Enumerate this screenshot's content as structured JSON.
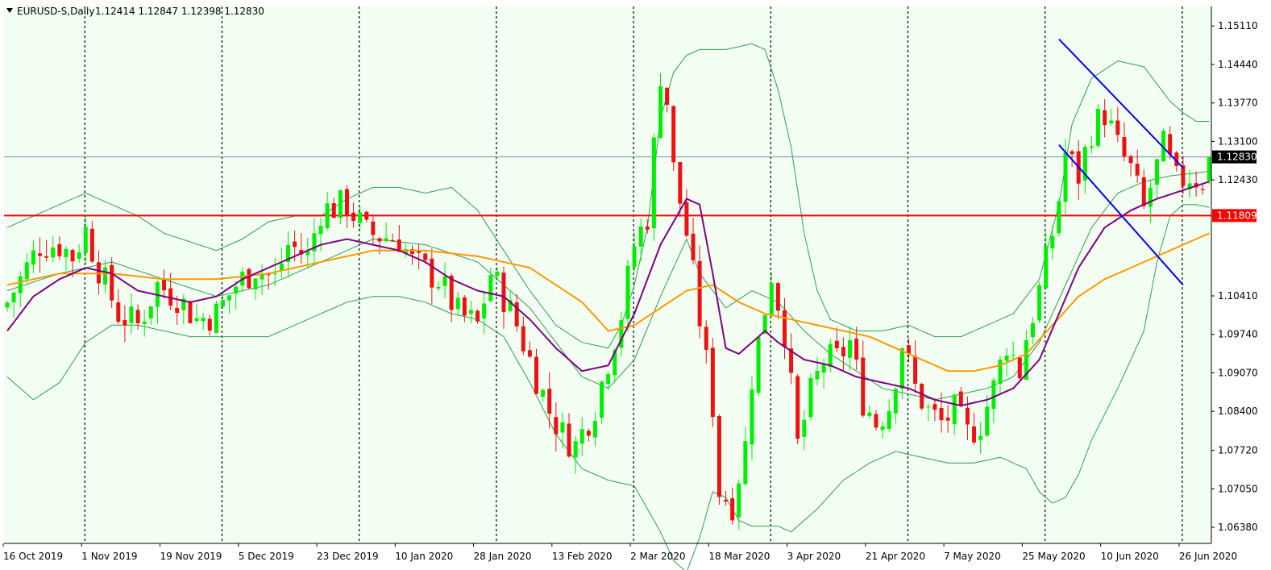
{
  "header": {
    "symbol": "EURUSD-S,Daily",
    "ohlc": "1.12414 1.12847 1.12398 1.12830"
  },
  "colors": {
    "background": "#f3fff3",
    "bull": "#00ee00",
    "bear": "#ee1111",
    "bollinger": "#2e9e52",
    "ma_fast": "#800080",
    "ma_slow": "#ff9900",
    "channel": "#0000ff",
    "support": "#ff0000",
    "last_price_line": "#6f8fa8"
  },
  "chart_data": {
    "type": "candlestick",
    "title": "",
    "ylim": [
      1.061,
      1.1545
    ],
    "yticks": [
      "1.15110",
      "1.14440",
      "1.13770",
      "1.13100",
      "1.12430",
      "1.10410",
      "1.09740",
      "1.09070",
      "1.08400",
      "1.07720",
      "1.07050",
      "1.06380"
    ],
    "ytick_values": [
      1.1511,
      1.1444,
      1.1377,
      1.131,
      1.1243,
      1.1041,
      1.0974,
      1.0907,
      1.084,
      1.0772,
      1.0705,
      1.0638
    ],
    "xtick_labels": [
      "16 Oct 2019",
      "1 Nov 2019",
      "19 Nov 2019",
      "5 Dec 2019",
      "23 Dec 2019",
      "10 Jan 2020",
      "28 Jan 2020",
      "13 Feb 2020",
      "2 Mar 2020",
      "18 Mar 2020",
      "3 Apr 2020",
      "21 Apr 2020",
      "7 May 2020",
      "25 May 2020",
      "10 Jun 2020",
      "26 Jun 2020"
    ],
    "xtick_index": [
      0,
      12,
      24,
      36,
      48,
      60,
      72,
      84,
      96,
      108,
      120,
      132,
      144,
      156,
      168,
      180
    ],
    "separator_index": [
      12,
      33,
      54,
      75,
      96,
      117,
      138,
      159,
      180
    ],
    "num_bars": 185,
    "horizontal_lines": [
      {
        "name": "support",
        "value": 1.11809,
        "label": "1.11809"
      },
      {
        "name": "last",
        "value": 1.1283,
        "label": "1.12830"
      }
    ],
    "channel_lines": [
      {
        "from": [
          161,
          1.1488
        ],
        "to": [
          180,
          1.1264
        ]
      },
      {
        "from": [
          161,
          1.1304
        ],
        "to": [
          180,
          1.106
        ]
      }
    ],
    "close_path": [
      [
        0,
        1.103
      ],
      [
        3,
        1.109
      ],
      [
        5,
        1.113
      ],
      [
        8,
        1.113
      ],
      [
        10,
        1.111
      ],
      [
        12,
        1.1155
      ],
      [
        14,
        1.109
      ],
      [
        17,
        1.101
      ],
      [
        20,
        1.099
      ],
      [
        23,
        1.106
      ],
      [
        26,
        1.104
      ],
      [
        29,
        1.1
      ],
      [
        32,
        1.101
      ],
      [
        35,
        1.106
      ],
      [
        38,
        1.109
      ],
      [
        41,
        1.107
      ],
      [
        43,
        1.113
      ],
      [
        46,
        1.111
      ],
      [
        48,
        1.119
      ],
      [
        52,
        1.12
      ],
      [
        55,
        1.115
      ],
      [
        60,
        1.114
      ],
      [
        62,
        1.11
      ],
      [
        66,
        1.107
      ],
      [
        69,
        1.101
      ],
      [
        72,
        1.099
      ],
      [
        74,
        1.108
      ],
      [
        76,
        1.104
      ],
      [
        78,
        1.099
      ],
      [
        81,
        1.09
      ],
      [
        83,
        1.084
      ],
      [
        85,
        1.08
      ],
      [
        87,
        1.078
      ],
      [
        90,
        1.085
      ],
      [
        92,
        1.093
      ],
      [
        94,
        1.101
      ],
      [
        96,
        1.113
      ],
      [
        98,
        1.118
      ],
      [
        99,
        1.13
      ],
      [
        100,
        1.143
      ],
      [
        101,
        1.138
      ],
      [
        102,
        1.126
      ],
      [
        104,
        1.115
      ],
      [
        106,
        1.1
      ],
      [
        108,
        1.085
      ],
      [
        109,
        1.07
      ],
      [
        111,
        1.068
      ],
      [
        113,
        1.078
      ],
      [
        114,
        1.09
      ],
      [
        116,
        1.102
      ],
      [
        117,
        1.108
      ],
      [
        119,
        1.098
      ],
      [
        120,
        1.088
      ],
      [
        121,
        1.078
      ],
      [
        123,
        1.087
      ],
      [
        125,
        1.093
      ],
      [
        127,
        1.093
      ],
      [
        129,
        1.096
      ],
      [
        131,
        1.086
      ],
      [
        133,
        1.082
      ],
      [
        135,
        1.085
      ],
      [
        137,
        1.096
      ],
      [
        139,
        1.088
      ],
      [
        141,
        1.084
      ],
      [
        143,
        1.082
      ],
      [
        145,
        1.084
      ],
      [
        147,
        1.08
      ],
      [
        149,
        1.082
      ],
      [
        151,
        1.088
      ],
      [
        153,
        1.096
      ],
      [
        155,
        1.091
      ],
      [
        156,
        1.097
      ],
      [
        158,
        1.105
      ],
      [
        160,
        1.115
      ],
      [
        161,
        1.121
      ],
      [
        162,
        1.129
      ],
      [
        164,
        1.125
      ],
      [
        166,
        1.133
      ],
      [
        168,
        1.136
      ],
      [
        170,
        1.13
      ],
      [
        172,
        1.126
      ],
      [
        174,
        1.119
      ],
      [
        175,
        1.123
      ],
      [
        177,
        1.13
      ],
      [
        179,
        1.124
      ],
      [
        181,
        1.125
      ],
      [
        183,
        1.1241
      ],
      [
        184,
        1.1283
      ]
    ],
    "ma_fast_path": [
      [
        0,
        1.098
      ],
      [
        4,
        1.104
      ],
      [
        8,
        1.107
      ],
      [
        12,
        1.109
      ],
      [
        16,
        1.108
      ],
      [
        20,
        1.105
      ],
      [
        24,
        1.104
      ],
      [
        28,
        1.103
      ],
      [
        32,
        1.104
      ],
      [
        36,
        1.107
      ],
      [
        40,
        1.109
      ],
      [
        44,
        1.111
      ],
      [
        48,
        1.113
      ],
      [
        52,
        1.114
      ],
      [
        56,
        1.113
      ],
      [
        60,
        1.112
      ],
      [
        64,
        1.11
      ],
      [
        68,
        1.107
      ],
      [
        72,
        1.105
      ],
      [
        76,
        1.104
      ],
      [
        80,
        1.1
      ],
      [
        84,
        1.095
      ],
      [
        88,
        1.091
      ],
      [
        92,
        1.092
      ],
      [
        96,
        1.101
      ],
      [
        100,
        1.113
      ],
      [
        104,
        1.121
      ],
      [
        106,
        1.12
      ],
      [
        108,
        1.108
      ],
      [
        110,
        1.095
      ],
      [
        112,
        1.094
      ],
      [
        114,
        1.096
      ],
      [
        116,
        1.098
      ],
      [
        118,
        1.096
      ],
      [
        122,
        1.093
      ],
      [
        126,
        1.092
      ],
      [
        130,
        1.09
      ],
      [
        134,
        1.089
      ],
      [
        138,
        1.088
      ],
      [
        142,
        1.086
      ],
      [
        146,
        1.085
      ],
      [
        150,
        1.086
      ],
      [
        154,
        1.088
      ],
      [
        158,
        1.093
      ],
      [
        161,
        1.101
      ],
      [
        164,
        1.109
      ],
      [
        168,
        1.116
      ],
      [
        172,
        1.119
      ],
      [
        176,
        1.121
      ],
      [
        180,
        1.1225
      ],
      [
        184,
        1.124
      ]
    ],
    "ma_slow_path": [
      [
        0,
        1.106
      ],
      [
        8,
        1.108
      ],
      [
        16,
        1.108
      ],
      [
        24,
        1.107
      ],
      [
        32,
        1.107
      ],
      [
        40,
        1.108
      ],
      [
        48,
        1.11
      ],
      [
        56,
        1.112
      ],
      [
        64,
        1.112
      ],
      [
        72,
        1.111
      ],
      [
        80,
        1.109
      ],
      [
        88,
        1.103
      ],
      [
        92,
        1.098
      ],
      [
        96,
        1.099
      ],
      [
        100,
        1.102
      ],
      [
        104,
        1.105
      ],
      [
        108,
        1.106
      ],
      [
        112,
        1.103
      ],
      [
        116,
        1.101
      ],
      [
        120,
        1.1
      ],
      [
        124,
        1.099
      ],
      [
        128,
        1.098
      ],
      [
        132,
        1.097
      ],
      [
        136,
        1.095
      ],
      [
        140,
        1.093
      ],
      [
        144,
        1.091
      ],
      [
        148,
        1.091
      ],
      [
        152,
        1.092
      ],
      [
        156,
        1.094
      ],
      [
        160,
        1.099
      ],
      [
        164,
        1.104
      ],
      [
        168,
        1.107
      ],
      [
        172,
        1.109
      ],
      [
        176,
        1.111
      ],
      [
        180,
        1.113
      ],
      [
        184,
        1.115
      ]
    ],
    "bb_mid_path": [
      [
        0,
        1.105
      ],
      [
        8,
        1.108
      ],
      [
        16,
        1.11
      ],
      [
        24,
        1.107
      ],
      [
        32,
        1.104
      ],
      [
        40,
        1.106
      ],
      [
        48,
        1.11
      ],
      [
        56,
        1.114
      ],
      [
        64,
        1.113
      ],
      [
        72,
        1.11
      ],
      [
        80,
        1.102
      ],
      [
        88,
        1.09
      ],
      [
        92,
        1.088
      ],
      [
        96,
        1.093
      ],
      [
        100,
        1.104
      ],
      [
        104,
        1.114
      ],
      [
        106,
        1.108
      ],
      [
        110,
        1.102
      ],
      [
        114,
        1.105
      ],
      [
        118,
        1.103
      ],
      [
        122,
        1.098
      ],
      [
        126,
        1.094
      ],
      [
        130,
        1.091
      ],
      [
        134,
        1.088
      ],
      [
        138,
        1.087
      ],
      [
        142,
        1.086
      ],
      [
        146,
        1.087
      ],
      [
        150,
        1.088
      ],
      [
        154,
        1.09
      ],
      [
        158,
        1.096
      ],
      [
        162,
        1.106
      ],
      [
        166,
        1.116
      ],
      [
        170,
        1.122
      ],
      [
        174,
        1.124
      ],
      [
        178,
        1.125
      ],
      [
        182,
        1.1255
      ],
      [
        184,
        1.1258
      ]
    ],
    "bb_upper_path": [
      [
        0,
        1.116
      ],
      [
        6,
        1.119
      ],
      [
        12,
        1.122
      ],
      [
        16,
        1.12
      ],
      [
        20,
        1.118
      ],
      [
        24,
        1.115
      ],
      [
        32,
        1.112
      ],
      [
        36,
        1.114
      ],
      [
        40,
        1.117
      ],
      [
        44,
        1.118
      ],
      [
        48,
        1.118
      ],
      [
        52,
        1.121
      ],
      [
        56,
        1.123
      ],
      [
        60,
        1.123
      ],
      [
        64,
        1.122
      ],
      [
        68,
        1.123
      ],
      [
        72,
        1.119
      ],
      [
        76,
        1.112
      ],
      [
        80,
        1.105
      ],
      [
        84,
        1.099
      ],
      [
        88,
        1.096
      ],
      [
        92,
        1.095
      ],
      [
        94,
        1.099
      ],
      [
        96,
        1.106
      ],
      [
        98,
        1.116
      ],
      [
        100,
        1.135
      ],
      [
        102,
        1.143
      ],
      [
        104,
        1.146
      ],
      [
        106,
        1.147
      ],
      [
        110,
        1.147
      ],
      [
        114,
        1.148
      ],
      [
        116,
        1.147
      ],
      [
        118,
        1.14
      ],
      [
        120,
        1.13
      ],
      [
        122,
        1.115
      ],
      [
        124,
        1.105
      ],
      [
        126,
        1.1
      ],
      [
        130,
        1.098
      ],
      [
        134,
        1.098
      ],
      [
        138,
        1.099
      ],
      [
        142,
        1.097
      ],
      [
        146,
        1.097
      ],
      [
        150,
        1.099
      ],
      [
        154,
        1.101
      ],
      [
        158,
        1.107
      ],
      [
        161,
        1.12
      ],
      [
        163,
        1.134
      ],
      [
        166,
        1.142
      ],
      [
        170,
        1.145
      ],
      [
        174,
        1.144
      ],
      [
        176,
        1.141
      ],
      [
        178,
        1.138
      ],
      [
        180,
        1.136
      ],
      [
        182,
        1.1345
      ],
      [
        184,
        1.1345
      ]
    ],
    "bb_lower_path": [
      [
        0,
        1.09
      ],
      [
        4,
        1.086
      ],
      [
        8,
        1.089
      ],
      [
        12,
        1.096
      ],
      [
        16,
        1.099
      ],
      [
        20,
        1.099
      ],
      [
        24,
        1.098
      ],
      [
        28,
        1.097
      ],
      [
        32,
        1.097
      ],
      [
        36,
        1.097
      ],
      [
        40,
        1.097
      ],
      [
        44,
        1.099
      ],
      [
        48,
        1.101
      ],
      [
        52,
        1.103
      ],
      [
        56,
        1.104
      ],
      [
        60,
        1.104
      ],
      [
        64,
        1.103
      ],
      [
        68,
        1.101
      ],
      [
        72,
        1.1
      ],
      [
        76,
        1.097
      ],
      [
        80,
        1.089
      ],
      [
        84,
        1.08
      ],
      [
        88,
        1.074
      ],
      [
        92,
        1.072
      ],
      [
        96,
        1.071
      ],
      [
        98,
        1.067
      ],
      [
        100,
        1.063
      ],
      [
        102,
        1.058
      ],
      [
        104,
        1.056
      ],
      [
        106,
        1.062
      ],
      [
        108,
        1.07
      ],
      [
        110,
        1.069
      ],
      [
        112,
        1.065
      ],
      [
        114,
        1.064
      ],
      [
        118,
        1.064
      ],
      [
        120,
        1.063
      ],
      [
        124,
        1.067
      ],
      [
        128,
        1.072
      ],
      [
        132,
        1.075
      ],
      [
        136,
        1.077
      ],
      [
        140,
        1.076
      ],
      [
        144,
        1.075
      ],
      [
        148,
        1.075
      ],
      [
        152,
        1.076
      ],
      [
        156,
        1.074
      ],
      [
        158,
        1.07
      ],
      [
        160,
        1.068
      ],
      [
        162,
        1.069
      ],
      [
        164,
        1.073
      ],
      [
        166,
        1.079
      ],
      [
        170,
        1.088
      ],
      [
        174,
        1.098
      ],
      [
        176,
        1.11
      ],
      [
        178,
        1.118
      ],
      [
        180,
        1.12
      ],
      [
        182,
        1.12
      ],
      [
        184,
        1.1195
      ]
    ]
  }
}
